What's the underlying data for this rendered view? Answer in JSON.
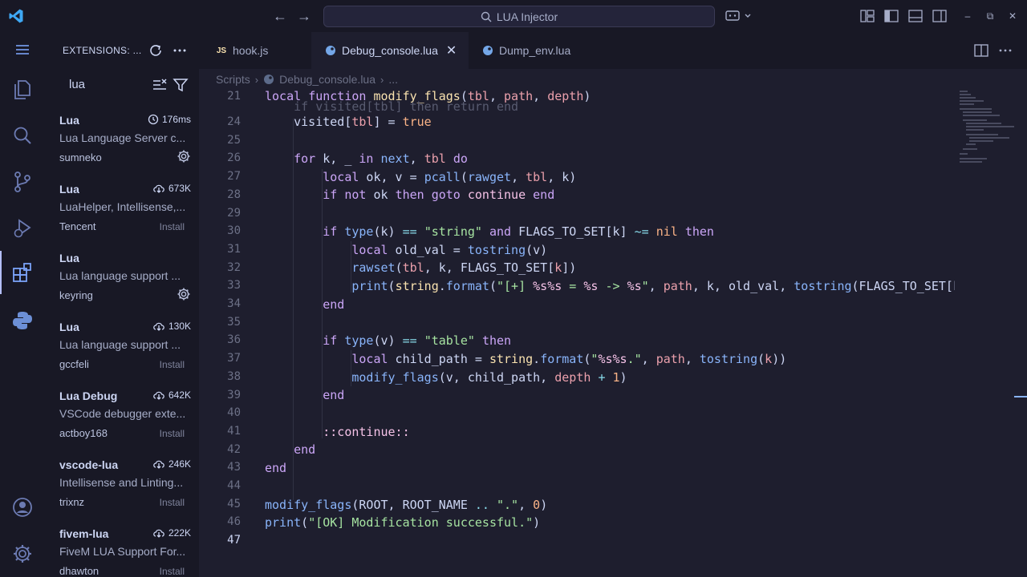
{
  "titlebar": {
    "search_text": "LUA Injector",
    "icons": [
      "vscode-logo-icon",
      "back-arrow-icon",
      "forward-arrow-icon",
      "search-icon",
      "copilot-icon",
      "layout-icon",
      "sidebar-toggle-icon",
      "panel-toggle-icon",
      "secondary-sidebar-icon",
      "minimize-icon",
      "restore-icon",
      "close-icon"
    ]
  },
  "activitybar": {
    "items": [
      "menu-icon",
      "explorer-icon",
      "search-icon",
      "source-control-icon",
      "run-debug-icon",
      "extensions-icon",
      "python-icon",
      "account-icon",
      "settings-icon"
    ]
  },
  "sidebar": {
    "title": "EXTENSIONS: ...",
    "search_value": "lua",
    "extensions": [
      {
        "name": "Lua",
        "stat": "176ms",
        "stat_icon": "history-icon",
        "desc": "Lua Language Server c...",
        "publisher": "sumneko",
        "action": "gear"
      },
      {
        "name": "Lua",
        "stat": "673K",
        "stat_icon": "download-cloud-icon",
        "desc": "LuaHelper, Intellisense,...",
        "publisher": "Tencent",
        "action": "Install"
      },
      {
        "name": "Lua",
        "stat": "",
        "stat_icon": "",
        "desc": "Lua language support ...",
        "publisher": "keyring",
        "action": "gear"
      },
      {
        "name": "Lua",
        "stat": "130K",
        "stat_icon": "download-cloud-icon",
        "desc": "Lua language support ...",
        "publisher": "gccfeli",
        "action": "Install"
      },
      {
        "name": "Lua Debug",
        "stat": "642K",
        "stat_icon": "download-cloud-icon",
        "desc": "VSCode debugger exte...",
        "publisher": "actboy168",
        "action": "Install"
      },
      {
        "name": "vscode-lua",
        "stat": "246K",
        "stat_icon": "download-cloud-icon",
        "desc": "Intellisense and Linting...",
        "publisher": "trixnz",
        "action": "Install"
      },
      {
        "name": "fivem-lua",
        "stat": "222K",
        "stat_icon": "download-cloud-icon",
        "desc": "FiveM LUA Support For...",
        "publisher": "dhawton",
        "action": "Install"
      }
    ]
  },
  "editor": {
    "tabs": [
      {
        "label": "hook.js",
        "icon": "JS"
      },
      {
        "label": "Debug_console.lua",
        "icon": "lua"
      },
      {
        "label": "Dump_env.lua",
        "icon": "lua"
      }
    ],
    "breadcrumb": [
      "Scripts",
      "Debug_console.lua",
      "..."
    ],
    "sticky_line_number": "21",
    "line_numbers": [
      "24",
      "25",
      "26",
      "27",
      "28",
      "29",
      "30",
      "31",
      "32",
      "33",
      "34",
      "35",
      "36",
      "37",
      "38",
      "39",
      "40",
      "41",
      "42",
      "43",
      "44",
      "45",
      "46",
      "47"
    ],
    "current_line": "47"
  }
}
